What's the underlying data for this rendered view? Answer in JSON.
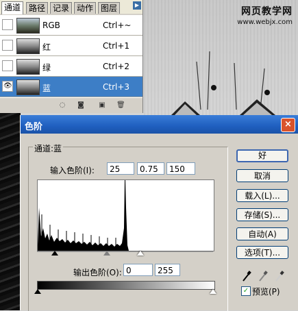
{
  "watermark": {
    "line1": "网页教学网",
    "line2": "www.webjx.com"
  },
  "channels_panel": {
    "tabs": [
      "通道",
      "路径",
      "记录",
      "动作",
      "图层"
    ],
    "channels": [
      {
        "name": "RGB",
        "shortcut": "Ctrl+~",
        "visible": false,
        "selected": false
      },
      {
        "name": "红",
        "shortcut": "Ctrl+1",
        "visible": false,
        "selected": false
      },
      {
        "name": "绿",
        "shortcut": "Ctrl+2",
        "visible": false,
        "selected": false
      },
      {
        "name": "蓝",
        "shortcut": "Ctrl+3",
        "visible": true,
        "selected": true
      }
    ]
  },
  "levels_dialog": {
    "title": "色阶",
    "channel_label": "通道:蓝",
    "input_levels_label": "输入色阶(I):",
    "input_black": "25",
    "input_gamma": "0.75",
    "input_white": "150",
    "output_levels_label": "输出色阶(O):",
    "output_black": "0",
    "output_white": "255",
    "buttons": {
      "ok": "好",
      "cancel": "取消",
      "load": "载入(L)...",
      "save": "存储(S)...",
      "auto": "自动(A)",
      "options": "选项(T)..."
    },
    "preview_label": "预览(P)",
    "preview_checked": true,
    "close_glyph": "×"
  },
  "colors": {
    "accent": "#3d7ec6",
    "titlebar": "#1f5fbf"
  }
}
